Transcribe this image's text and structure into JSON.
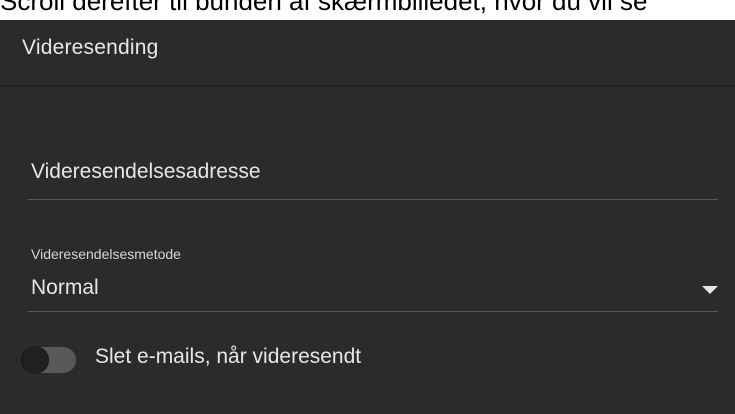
{
  "caption": {
    "text": "Scroll derefter til bunden af skærmbilledet, hvor du vil se"
  },
  "panel": {
    "title": "Videresending"
  },
  "form": {
    "address_field": {
      "placeholder": "Videresendelsesadresse"
    },
    "method": {
      "label": "Videresendelsesmetode",
      "value": "Normal"
    },
    "delete_toggle": {
      "label": "Slet e-mails, når videresendt",
      "on": false
    }
  },
  "colors": {
    "panel_bg": "#2b2b2b",
    "text": "#e6e6e6",
    "divider": "#5a5a5a",
    "toggle_track": "#595959"
  },
  "icons": {
    "dropdown": "chevron-down-icon"
  }
}
